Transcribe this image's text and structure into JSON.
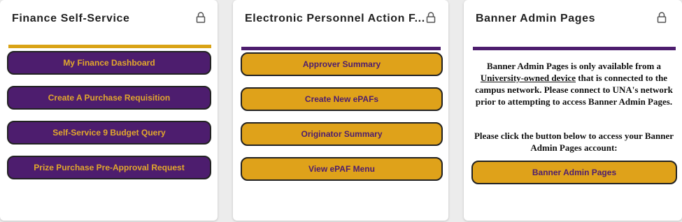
{
  "finance": {
    "title": "Finance  Self-Service",
    "buttons": [
      {
        "label": "My Finance Dashboard"
      },
      {
        "label": "Create A Purchase Requisition"
      },
      {
        "label": "Self-Service 9 Budget Query"
      },
      {
        "label": "Prize Purchase Pre-Approval Request"
      }
    ]
  },
  "epaf": {
    "title": "Electronic  Personnel  Action  F...",
    "buttons": [
      {
        "label": "Approver Summary"
      },
      {
        "label": "Create New ePAFs"
      },
      {
        "label": "Originator Summary"
      },
      {
        "label": "View ePAF Menu"
      }
    ]
  },
  "banner": {
    "title": "Banner  Admin  Pages",
    "notice_prefix": "Banner Admin Pages is only available from a",
    "notice_link": "University-owned device",
    "notice_suffix": "that is connected to the campus network. Please connect to UNA's network prior to attempting to access Banner Admin Pages.",
    "notice_second": "Please click the button below to access your Banner Admin Pages account:",
    "button_label": "Banner Admin Pages"
  },
  "colors": {
    "purple": "#4d1d6e",
    "gold": "#dfa21a",
    "card_bg": "#ffffff",
    "page_bg": "#ececec"
  },
  "icons": {
    "lock": "lock-icon"
  }
}
